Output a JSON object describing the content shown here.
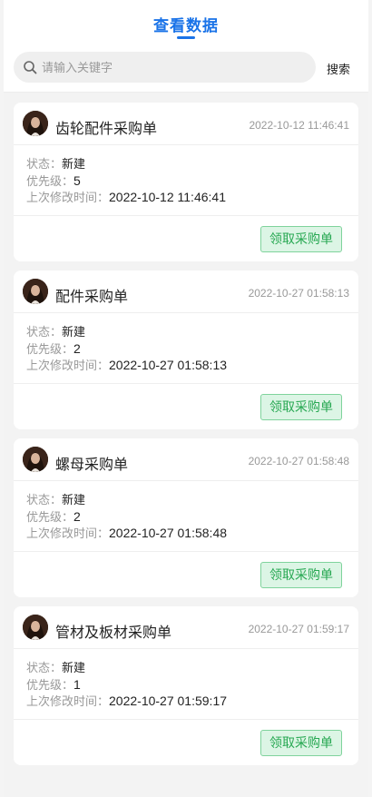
{
  "header": {
    "tab_title": "查看数据",
    "search_placeholder": "请输入关键字",
    "search_button": "搜索"
  },
  "labels": {
    "status": "状态：",
    "priority": "优先级：",
    "modified": "上次修改时间："
  },
  "colors": {
    "accent": "#1a73e8",
    "button_bg": "#dcf5e5",
    "button_border": "#7fd39c",
    "button_text": "#27a852"
  },
  "cards": [
    {
      "title": "齿轮配件采购单",
      "time": "2022-10-12 11:46:41",
      "status": "新建",
      "priority": "5",
      "modified": "2022-10-12 11:46:41",
      "action": "领取采购单"
    },
    {
      "title": "配件采购单",
      "time": "2022-10-27 01:58:13",
      "status": "新建",
      "priority": "2",
      "modified": "2022-10-27 01:58:13",
      "action": "领取采购单"
    },
    {
      "title": "螺母采购单",
      "time": "2022-10-27 01:58:48",
      "status": "新建",
      "priority": "2",
      "modified": "2022-10-27 01:58:48",
      "action": "领取采购单"
    },
    {
      "title": "管材及板材采购单",
      "time": "2022-10-27 01:59:17",
      "status": "新建",
      "priority": "1",
      "modified": "2022-10-27 01:59:17",
      "action": "领取采购单"
    }
  ]
}
